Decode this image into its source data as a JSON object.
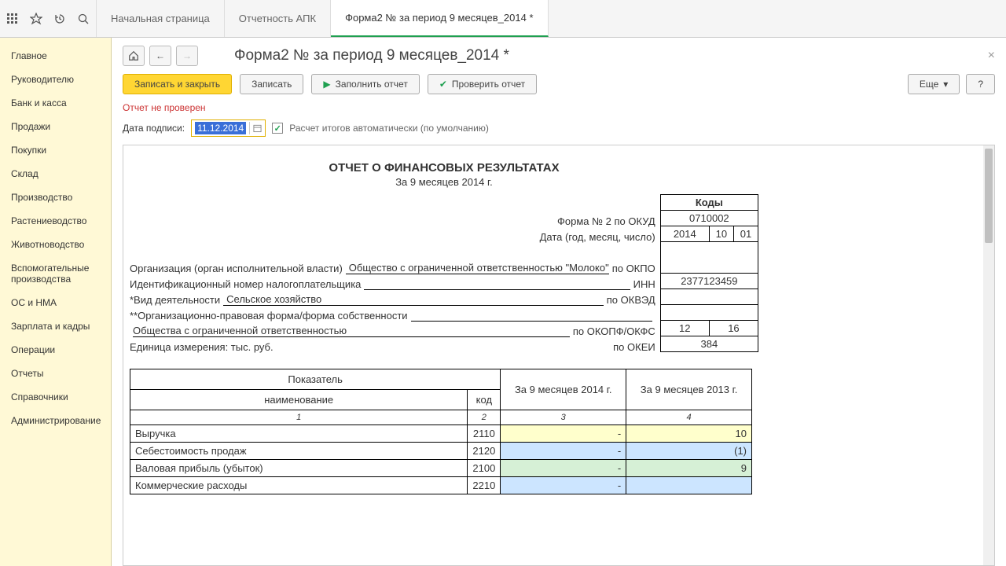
{
  "tabs": [
    "Начальная страница",
    "Отчетность АПК",
    "Форма2 №  за период 9 месяцев_2014 *"
  ],
  "active_tab": 2,
  "sidebar": [
    "Главное",
    "Руководителю",
    "Банк и касса",
    "Продажи",
    "Покупки",
    "Склад",
    "Производство",
    "Растениеводство",
    "Животноводство",
    "Вспомогательные производства",
    "ОС и НМА",
    "Зарплата и кадры",
    "Операции",
    "Отчеты",
    "Справочники",
    "Администрирование"
  ],
  "doc_title": "Форма2 №  за период 9 месяцев_2014 *",
  "buttons": {
    "save_close": "Записать и закрыть",
    "save": "Записать",
    "fill": "Заполнить отчет",
    "check": "Проверить отчет",
    "more": "Еще",
    "help": "?"
  },
  "status": "Отчет не проверен",
  "sig_label": "Дата подписи:",
  "sig_date": "11.12.2014",
  "auto_calc": "Расчет итогов автоматически (по умолчанию)",
  "report": {
    "title": "ОТЧЕТ О ФИНАНСОВЫХ РЕЗУЛЬТАТАХ",
    "subtitle": "За 9 месяцев 2014 г.",
    "codes_header": "Коды",
    "okud_label": "Форма № 2 по ОКУД",
    "okud": "0710002",
    "date_label": "Дата (год, месяц, число)",
    "date_y": "2014",
    "date_m": "10",
    "date_d": "01",
    "org_label": "Организация (орган исполнительной власти)",
    "org_val": "Общество с ограниченной ответственностью \"Молоко\"",
    "okpo_label": "по ОКПО",
    "inn_label": "Идентификационный номер налогоплательщика",
    "inn_code": "ИНН",
    "inn_val": "2377123459",
    "activity_label": "*Вид деятельности",
    "activity_val": "Сельское хозяйство",
    "okved_label": "по ОКВЭД",
    "form_label": "**Организационно-правовая форма/форма собственности",
    "form_val": "Общества с ограниченной ответственностью",
    "okopf_label": "по ОКОПФ/ОКФС",
    "okopf_1": "12",
    "okopf_2": "16",
    "unit_label": "Единица измерения: тыс. руб.",
    "okei_label": "по ОКЕИ",
    "okei_val": "384"
  },
  "table": {
    "col_indicator": "Показатель",
    "col_name": "наименование",
    "col_code": "код",
    "col_p1": "За 9 месяцев 2014 г.",
    "col_p2": "За 9 месяцев 2013 г.",
    "numrow": [
      "1",
      "2",
      "3",
      "4"
    ],
    "rows": [
      {
        "name": "Выручка",
        "code": "2110",
        "v1": "-",
        "v2": "10",
        "bg": "yellow"
      },
      {
        "name": "Себестоимость продаж",
        "code": "2120",
        "v1": "-",
        "v2": "(1)",
        "bg": "blue"
      },
      {
        "name": "Валовая прибыль (убыток)",
        "code": "2100",
        "v1": "-",
        "v2": "9",
        "bg": "green"
      },
      {
        "name": "Коммерческие расходы",
        "code": "2210",
        "v1": "-",
        "v2": "",
        "bg": "blue"
      }
    ]
  }
}
